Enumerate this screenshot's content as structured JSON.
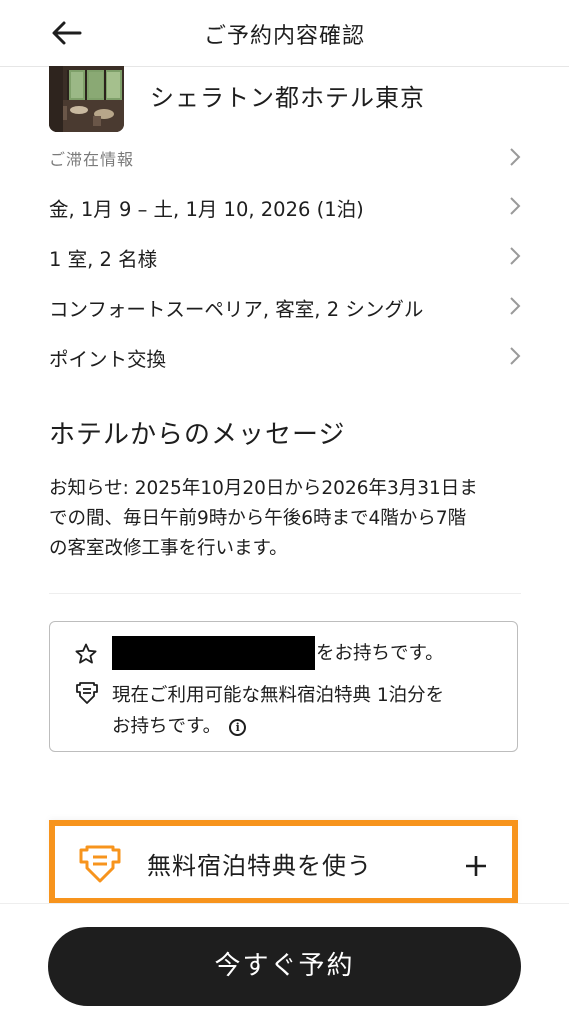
{
  "header": {
    "title": "ご予約内容確認"
  },
  "hotel": {
    "name": "シェラトン都ホテル東京"
  },
  "rows": [
    {
      "label": "ご滞在情報"
    },
    {
      "label": "金, 1月 9 – 土, 1月 10, 2026 (1泊)"
    },
    {
      "label": "1 室, 2 名様"
    },
    {
      "label": "コンフォートスーペリア, 客室, 2 シングル"
    },
    {
      "label": "ポイント交換"
    }
  ],
  "message": {
    "heading": "ホテルからのメッセージ",
    "lines": [
      "お知らせ: 2025年10月20日から2026年3月31日ま",
      "での間、毎日午前9時から午後6時まで4階から7階",
      "の客室改修工事を行います。"
    ]
  },
  "membership": {
    "owned_suffix": "をお持ちです。",
    "benefit_line1": "現在ご利用可能な無料宿泊特典 1泊分を",
    "benefit_line2": "お持ちです。",
    "info_glyph": "i"
  },
  "certificate": {
    "label": "無料宿泊特典を使う"
  },
  "book": {
    "label": "今すぐ予約"
  },
  "colors": {
    "accent": "#f7941d",
    "button_bg": "#1e1e1e",
    "text": "#1e1e1e",
    "muted": "#7a7a7a"
  },
  "icons": [
    "back-arrow-icon",
    "chevron-right-icon",
    "star-icon",
    "certificate-icon",
    "info-icon",
    "plus-icon"
  ]
}
